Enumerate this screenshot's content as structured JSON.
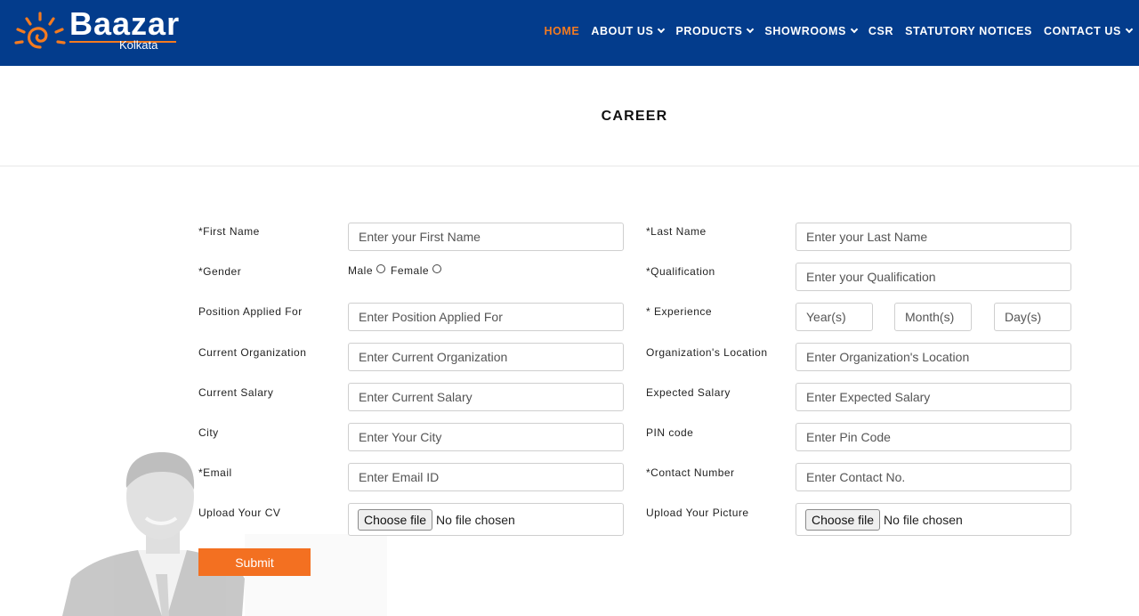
{
  "brand": {
    "name": "Baazar",
    "city": "Kolkata",
    "accent": "#f47b20",
    "header_bg": "#033c8c"
  },
  "nav": [
    {
      "label": "HOME",
      "active": true,
      "dropdown": false
    },
    {
      "label": "ABOUT US",
      "active": false,
      "dropdown": true
    },
    {
      "label": "PRODUCTS",
      "active": false,
      "dropdown": true
    },
    {
      "label": "SHOWROOMS",
      "active": false,
      "dropdown": true
    },
    {
      "label": "CSR",
      "active": false,
      "dropdown": false
    },
    {
      "label": "STATUTORY NOTICES",
      "active": false,
      "dropdown": false
    },
    {
      "label": "CONTACT US",
      "active": false,
      "dropdown": true
    }
  ],
  "page": {
    "title": "CAREER"
  },
  "form": {
    "first_name": {
      "label": "*First Name",
      "placeholder": "Enter your First Name"
    },
    "last_name": {
      "label": "*Last Name",
      "placeholder": "Enter your Last Name"
    },
    "gender": {
      "label": "*Gender",
      "options": [
        "Male",
        "Female"
      ]
    },
    "qualification": {
      "label": "*Qualification",
      "placeholder": "Enter your Qualification"
    },
    "position": {
      "label": "Position Applied For",
      "placeholder": "Enter Position Applied For"
    },
    "experience": {
      "label": "* Experience",
      "years": "Year(s)",
      "months": "Month(s)",
      "days": "Day(s)"
    },
    "current_org": {
      "label": "Current Organization",
      "placeholder": "Enter Current Organization"
    },
    "org_location": {
      "label": "Organization's Location",
      "placeholder": "Enter Organization's Location"
    },
    "current_salary": {
      "label": "Current Salary",
      "placeholder": "Enter Current Salary"
    },
    "expected_salary": {
      "label": "Expected Salary",
      "placeholder": "Enter Expected Salary"
    },
    "city": {
      "label": "City",
      "placeholder": "Enter Your City"
    },
    "pin": {
      "label": "PIN code",
      "placeholder": "Enter Pin Code"
    },
    "email": {
      "label": "*Email",
      "placeholder": "Enter Email ID"
    },
    "contact": {
      "label": "*Contact Number",
      "placeholder": "Enter Contact No."
    },
    "cv": {
      "label": "Upload Your CV",
      "button": "Choose file",
      "status": "No file chosen"
    },
    "picture": {
      "label": "Upload Your Picture",
      "button": "Choose file",
      "status": "No file chosen"
    },
    "submit": "Submit"
  }
}
